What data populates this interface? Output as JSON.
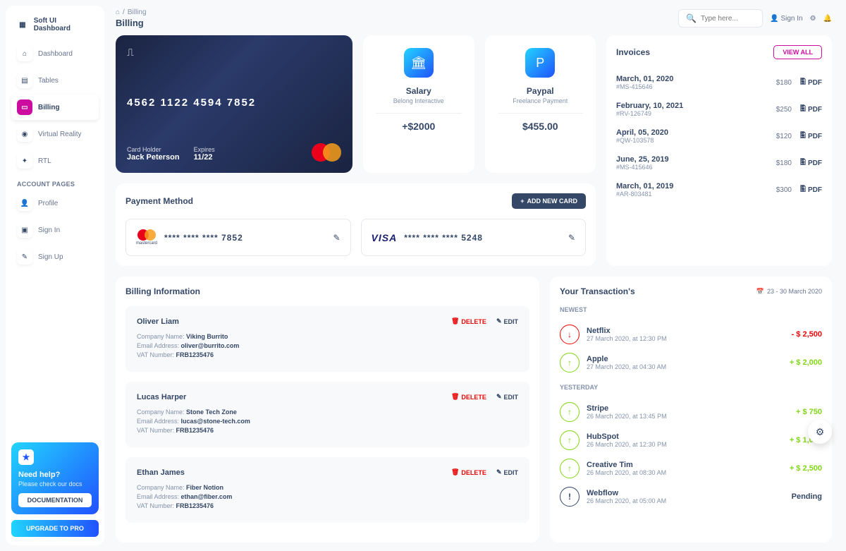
{
  "brand": "Soft UI Dashboard",
  "sidebar": {
    "items": [
      {
        "label": "Dashboard"
      },
      {
        "label": "Tables"
      },
      {
        "label": "Billing"
      },
      {
        "label": "Virtual Reality"
      },
      {
        "label": "RTL"
      }
    ],
    "section": "ACCOUNT PAGES",
    "account": [
      {
        "label": "Profile"
      },
      {
        "label": "Sign In"
      },
      {
        "label": "Sign Up"
      }
    ]
  },
  "help": {
    "title": "Need help?",
    "sub": "Please check our docs",
    "btn": "DOCUMENTATION"
  },
  "upgrade": "UPGRADE TO PRO",
  "breadcrumb": {
    "sep": "/",
    "page": "Billing"
  },
  "page_title": "Billing",
  "search": {
    "placeholder": "Type here..."
  },
  "signin": "Sign In",
  "cc": {
    "number": "4562   1122   4594   7852",
    "holder_label": "Card Holder",
    "holder": "Jack Peterson",
    "exp_label": "Expires",
    "exp": "11/22"
  },
  "salary": {
    "title": "Salary",
    "sub": "Belong Interactive",
    "val": "+$2000"
  },
  "paypal": {
    "title": "Paypal",
    "sub": "Freelance Payment",
    "val": "$455.00"
  },
  "invoices": {
    "title": "Invoices",
    "viewall": "VIEW ALL",
    "pdf": "PDF",
    "items": [
      {
        "date": "March, 01, 2020",
        "id": "#MS-415646",
        "amt": "$180"
      },
      {
        "date": "February, 10, 2021",
        "id": "#RV-126749",
        "amt": "$250"
      },
      {
        "date": "April, 05, 2020",
        "id": "#QW-103578",
        "amt": "$120"
      },
      {
        "date": "June, 25, 2019",
        "id": "#MS-415646",
        "amt": "$180"
      },
      {
        "date": "March, 01, 2019",
        "id": "#AR-803481",
        "amt": "$300"
      }
    ]
  },
  "pm": {
    "title": "Payment Method",
    "add": "ADD NEW CARD",
    "mc_label": "mastercard",
    "c1": "****   ****   ****   7852",
    "c2": "****   ****   ****   5248",
    "visa": "VISA"
  },
  "billing": {
    "title": "Billing Information",
    "del": "DELETE",
    "edit": "EDIT",
    "cl": "Company Name:",
    "el": "Email Address:",
    "vl": "VAT Number:",
    "items": [
      {
        "name": "Oliver Liam",
        "company": "Viking Burrito",
        "email": "oliver@burrito.com",
        "vat": "FRB1235476"
      },
      {
        "name": "Lucas Harper",
        "company": "Stone Tech Zone",
        "email": "lucas@stone-tech.com",
        "vat": "FRB1235476"
      },
      {
        "name": "Ethan James",
        "company": "Fiber Notion",
        "email": "ethan@fiber.com",
        "vat": "FRB1235476"
      }
    ]
  },
  "tx": {
    "title": "Your Transaction's",
    "range": "23 - 30 March 2020",
    "newest": "NEWEST",
    "yesterday": "YESTERDAY",
    "n": [
      {
        "name": "Netflix",
        "date": "27 March 2020, at 12:30 PM",
        "amt": "- $ 2,500",
        "dir": "down"
      },
      {
        "name": "Apple",
        "date": "27 March 2020, at 04:30 AM",
        "amt": "+ $ 2,000",
        "dir": "up"
      }
    ],
    "y": [
      {
        "name": "Stripe",
        "date": "26 March 2020, at 13:45 PM",
        "amt": "+ $ 750",
        "dir": "up"
      },
      {
        "name": "HubSpot",
        "date": "26 March 2020, at 12:30 PM",
        "amt": "+ $ 1,000",
        "dir": "up"
      },
      {
        "name": "Creative Tim",
        "date": "26 March 2020, at 08:30 AM",
        "amt": "+ $ 2,500",
        "dir": "up"
      },
      {
        "name": "Webflow",
        "date": "26 March 2020, at 05:00 AM",
        "amt": "Pending",
        "dir": "pend"
      }
    ]
  }
}
